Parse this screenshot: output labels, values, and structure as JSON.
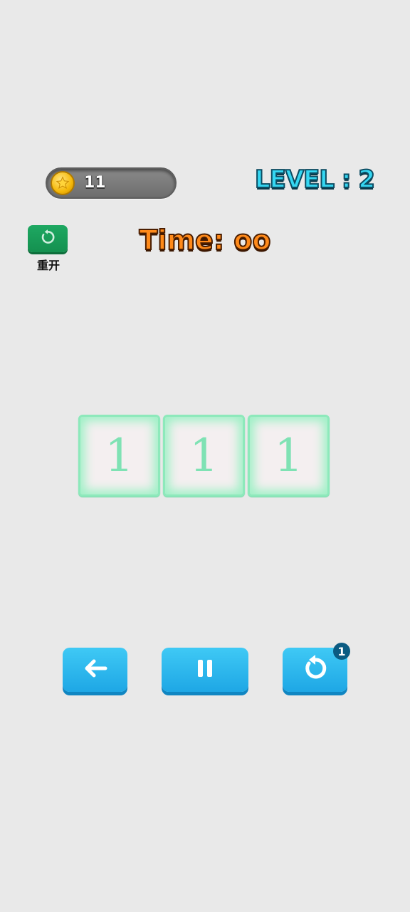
{
  "hud": {
    "coins": "11",
    "coin_icon": "star-coin-icon",
    "level": "LEVEL : 2"
  },
  "restart": {
    "icon": "restart-icon",
    "label": "重开"
  },
  "timer": {
    "label": "Time: oo"
  },
  "tiles": [
    "1",
    "1",
    "1"
  ],
  "controls": {
    "back_icon": "arrow-left-icon",
    "pause_icon": "pause-icon",
    "undo_icon": "undo-icon",
    "undo_badge": "1"
  },
  "colors": {
    "background": "#e9e9e9",
    "level_text": "#35d7f2",
    "timer_text": "#ff8a1a",
    "tile_border": "#8de9bb",
    "button": "#1ea7e5",
    "restart_button": "#1ea862"
  }
}
